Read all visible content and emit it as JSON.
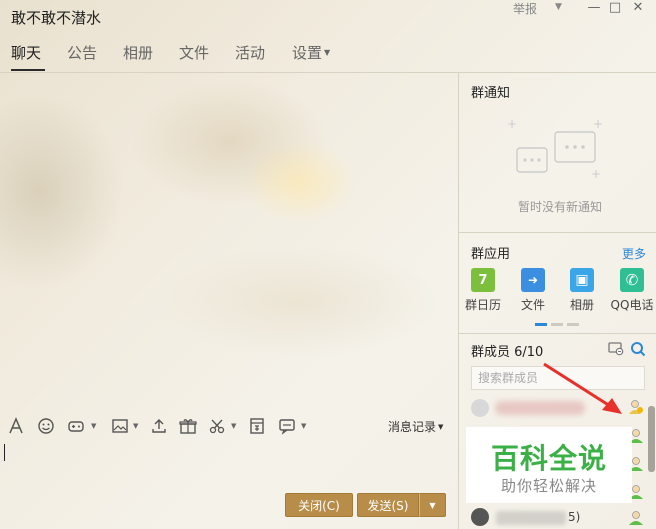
{
  "window": {
    "title": "敢不敢不潜水",
    "report_label": "举报",
    "controls": {
      "minimize": "—",
      "maximize": "□",
      "close": "✕"
    }
  },
  "tabs": [
    {
      "label": "聊天",
      "active": true
    },
    {
      "label": "公告"
    },
    {
      "label": "相册"
    },
    {
      "label": "文件"
    },
    {
      "label": "活动"
    },
    {
      "label": "设置",
      "has_dropdown": true
    }
  ],
  "toolbar": {
    "icons": [
      "font-icon",
      "emoji-icon",
      "game-icon",
      "image-icon",
      "upload-icon",
      "gift-icon",
      "scissors-icon",
      "redpacket-icon",
      "chat-bubble-icon"
    ],
    "history_label": "消息记录"
  },
  "buttons": {
    "close_label": "关闭(C)",
    "send_label": "发送(S)",
    "send_dropdown": "▼"
  },
  "notice": {
    "title": "群通知",
    "empty_text": "暂时没有新通知"
  },
  "apps": {
    "title": "群应用",
    "more_label": "更多",
    "items": [
      {
        "label": "群日历",
        "icon": "calendar-icon",
        "color": "#7bbf3c",
        "glyph": "7"
      },
      {
        "label": "文件",
        "icon": "file-icon",
        "color": "#3a8fe0",
        "glyph": "➜"
      },
      {
        "label": "相册",
        "icon": "album-icon",
        "color": "#3aa6e8",
        "glyph": "▣"
      },
      {
        "label": "QQ电话",
        "icon": "phone-icon",
        "color": "#2fbf92",
        "glyph": "✆"
      }
    ]
  },
  "members": {
    "title": "群成员 6/10",
    "search_placeholder": "搜索群成员",
    "visible_count_label": "5)"
  },
  "watermark": {
    "main": "百科全说",
    "sub": "助你轻松解决"
  },
  "colors": {
    "accent": "#2b88d9",
    "button": "#b78d49",
    "watermark_green": "#3bb046",
    "arrow_red": "#e8302a"
  }
}
